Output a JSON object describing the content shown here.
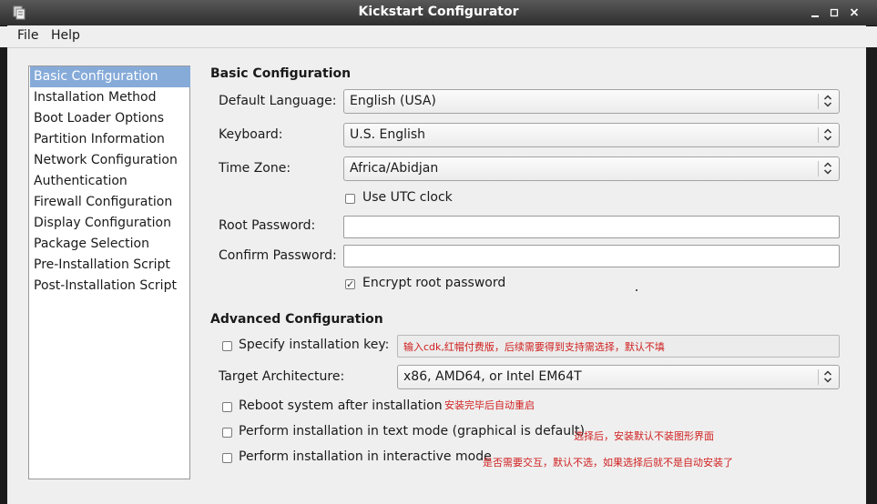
{
  "window": {
    "title": "Kickstart Configurator"
  },
  "menubar": {
    "file": "File",
    "help": "Help"
  },
  "sidebar": {
    "items": [
      "Basic Configuration",
      "Installation Method",
      "Boot Loader Options",
      "Partition Information",
      "Network Configuration",
      "Authentication",
      "Firewall Configuration",
      "Display Configuration",
      "Package Selection",
      "Pre-Installation Script",
      "Post-Installation Script"
    ],
    "selected": "Basic Configuration"
  },
  "basic": {
    "title": "Basic Configuration",
    "default_language_label": "Default Language:",
    "default_language_value": "English (USA)",
    "keyboard_label": "Keyboard:",
    "keyboard_value": "U.S. English",
    "timezone_label": "Time Zone:",
    "timezone_value": "Africa/Abidjan",
    "utc_label": "Use UTC clock",
    "utc_checked": false,
    "root_password_label": "Root Password:",
    "root_password_value": "",
    "confirm_password_label": "Confirm Password:",
    "confirm_password_value": "",
    "encrypt_label": "Encrypt root password",
    "encrypt_checked": true
  },
  "advanced": {
    "title": "Advanced Configuration",
    "install_key_label": "Specify installation key:",
    "install_key_checked": false,
    "install_key_note": "输入cdk,红帽付费版，后续需要得到支持需选择，默认不填",
    "target_arch_label": "Target Architecture:",
    "target_arch_value": "x86, AMD64, or Intel EM64T",
    "reboot_label": "Reboot system after installation",
    "reboot_checked": false,
    "reboot_note": "安装完毕后自动重启",
    "text_mode_label": "Perform installation in text mode (graphical is default)",
    "text_mode_checked": false,
    "text_mode_note": "选择后，安装默认不装图形界面",
    "interactive_label": "Perform installation in interactive mode",
    "interactive_checked": false,
    "interactive_note": "是否需要交互，默认不选，如果选择后就不是自动安装了"
  },
  "icons": {
    "app": "kickstart-app-icon",
    "minimize": "minimize-icon",
    "maximize": "maximize-icon",
    "close": "close-icon",
    "combo": "combo-arrows-icon",
    "checkbox": "checkbox-icon"
  },
  "colors": {
    "selection": "#86abd9",
    "note": "#d02020",
    "titlebar": "#3a3a3a"
  }
}
